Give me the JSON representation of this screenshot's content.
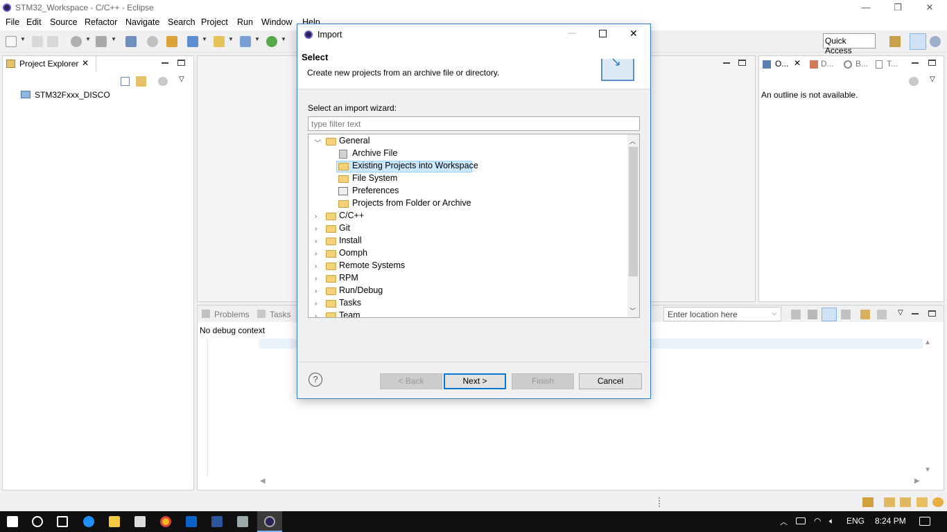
{
  "window": {
    "title": "STM32_Workspace - C/C++ - Eclipse",
    "minimize": "—",
    "restore": "❐",
    "close": "✕"
  },
  "menu": [
    "File",
    "Edit",
    "Source",
    "Refactor",
    "Navigate",
    "Search",
    "Project",
    "Run",
    "Window",
    "Help"
  ],
  "toolbar": {
    "quick_access": "Quick Access"
  },
  "project_explorer": {
    "tab_label": "Project Explorer",
    "items": [
      "STM32Fxxx_DISCO"
    ]
  },
  "outline": {
    "tabs": [
      "O...",
      "D...",
      "B...",
      "T..."
    ],
    "message": "An outline is not available."
  },
  "bottom_panel": {
    "tabs": [
      "Problems",
      "Tasks"
    ],
    "message": "No debug context",
    "location_placeholder": "Enter location here"
  },
  "dialog": {
    "title": "Import",
    "header_title": "Select",
    "header_description": "Create new projects from an archive file or directory.",
    "wizard_label": "Select an import wizard:",
    "filter_placeholder": "type filter text",
    "tree": {
      "general": "General",
      "general_children": [
        "Archive File",
        "Existing Projects into Workspace",
        "File System",
        "Preferences",
        "Projects from Folder or Archive"
      ],
      "selected": "Existing Projects into Workspace",
      "categories": [
        "C/C++",
        "Git",
        "Install",
        "Oomph",
        "Remote Systems",
        "RPM",
        "Run/Debug",
        "Tasks",
        "Team"
      ]
    },
    "buttons": {
      "help": "?",
      "back": "< Back",
      "next": "Next >",
      "finish": "Finish",
      "cancel": "Cancel"
    }
  },
  "taskbar": {
    "language": "ENG",
    "time": "8:24 PM"
  }
}
